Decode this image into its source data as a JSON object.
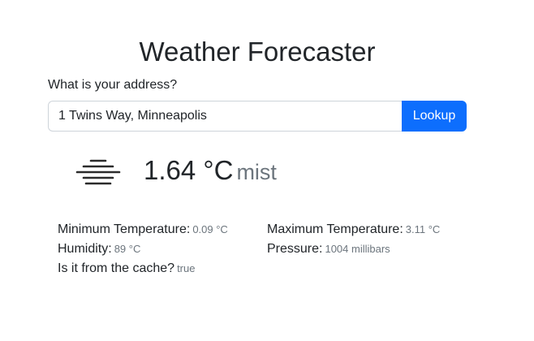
{
  "header": {
    "title": "Weather Forecaster"
  },
  "form": {
    "address_label": "What is your address?",
    "address_value": "1 Twins Way, Minneapolis",
    "lookup_label": "Lookup"
  },
  "current": {
    "icon": "mist-icon",
    "temperature": "1.64 °C",
    "description": "mist"
  },
  "details": {
    "min_temp_label": "Minimum Temperature:",
    "min_temp_value": "0.09 °C",
    "max_temp_label": "Maximum Temperature:",
    "max_temp_value": "3.11 °C",
    "humidity_label": "Humidity:",
    "humidity_value": "89 °C",
    "pressure_label": "Pressure:",
    "pressure_value": "1004 millibars",
    "cache_label": "Is it from the cache?",
    "cache_value": "true"
  },
  "colors": {
    "accent": "#0d6efd",
    "muted": "#6c757d",
    "text": "#212529"
  }
}
